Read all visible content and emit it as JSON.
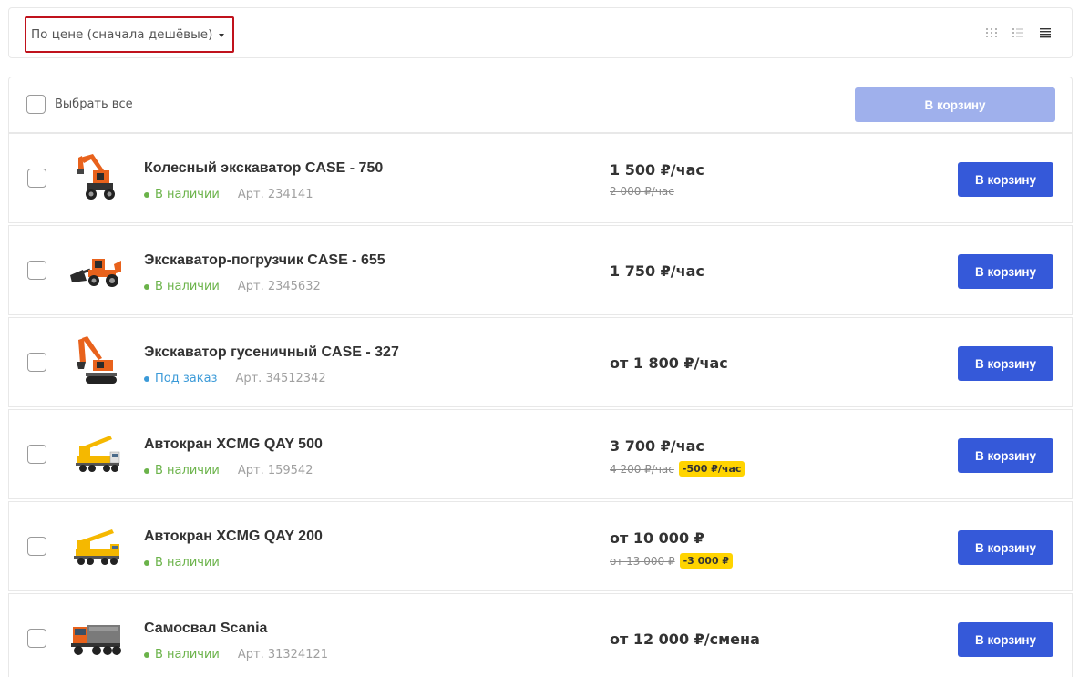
{
  "toolbar": {
    "sort_value": "По цене (сначала дешёвые)",
    "view_modes": [
      "grid-view-icon",
      "list-view-icon",
      "table-view-icon"
    ],
    "active_view": "table"
  },
  "select_all": {
    "label": "Выбрать все",
    "cart_button": "В корзину"
  },
  "colors": {
    "accent": "#3559d9",
    "accent_disabled": "#9fb0ec",
    "in_stock": "#6bb34a",
    "on_order": "#3b9ad8",
    "discount_badge": "#ffd400",
    "sort_highlight": "#c0121c"
  },
  "products": [
    {
      "name": "Колесный экскаватор CASE - 750",
      "status": "В наличии",
      "status_type": "in-stock",
      "article": "Арт. 234141",
      "price": "1 500 ₽/час",
      "old_price": "2 000 ₽/час",
      "discount": "",
      "image": "wheeled-excavator",
      "cart_button": "В корзину"
    },
    {
      "name": "Экскаватор-погрузчик CASE - 655",
      "status": "В наличии",
      "status_type": "in-stock",
      "article": "Арт. 2345632",
      "price": "1 750 ₽/час",
      "old_price": "",
      "discount": "",
      "image": "backhoe-loader",
      "cart_button": "В корзину"
    },
    {
      "name": "Экскаватор гусеничный CASE - 327",
      "status": "Под заказ",
      "status_type": "on-order",
      "article": "Арт. 34512342",
      "price": "от 1 800 ₽/час",
      "old_price": "",
      "discount": "",
      "image": "crawler-excavator",
      "cart_button": "В корзину"
    },
    {
      "name": "Автокран XCMG QAY 500",
      "status": "В наличии",
      "status_type": "in-stock",
      "article": "Арт. 159542",
      "price": "3 700 ₽/час",
      "old_price": "4 200 ₽/час",
      "discount": "-500 ₽/час",
      "image": "truck-crane",
      "cart_button": "В корзину"
    },
    {
      "name": "Автокран XCMG QAY 200",
      "status": "В наличии",
      "status_type": "in-stock",
      "article": "",
      "price": "от 10 000 ₽",
      "old_price": "от 13 000 ₽",
      "discount": "-3 000 ₽",
      "image": "truck-crane-2",
      "cart_button": "В корзину"
    },
    {
      "name": "Самосвал Scania",
      "status": "В наличии",
      "status_type": "in-stock",
      "article": "Арт. 31324121",
      "price": "от 12 000 ₽/смена",
      "old_price": "",
      "discount": "",
      "image": "dump-truck",
      "cart_button": "В корзину"
    }
  ]
}
